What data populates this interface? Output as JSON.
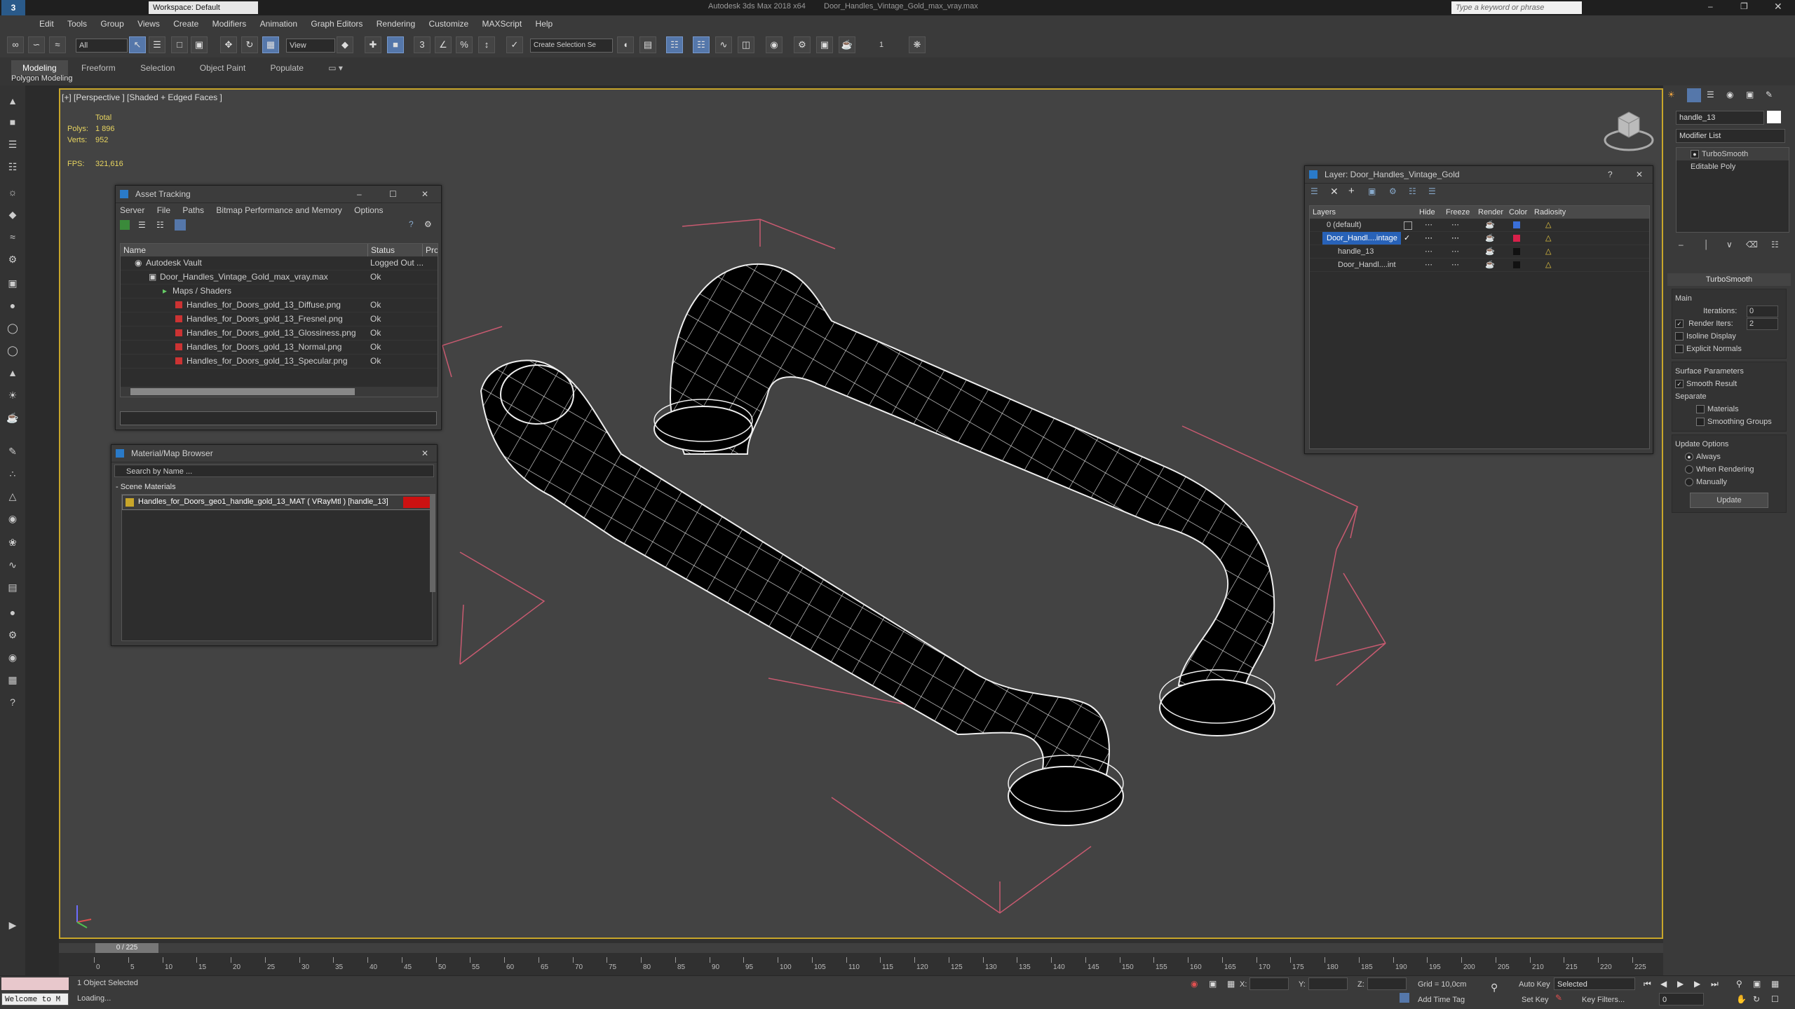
{
  "titlebar": {
    "workspace_label": "Workspace: Default",
    "app_title": "Autodesk 3ds Max  2018 x64",
    "file_title": "Door_Handles_Vintage_Gold_max_vray.max",
    "search_placeholder": "Type a keyword or phrase"
  },
  "menubar": {
    "items": [
      "Edit",
      "Tools",
      "Group",
      "Views",
      "Create",
      "Modifiers",
      "Animation",
      "Graph Editors",
      "Rendering",
      "Customize",
      "MAXScript",
      "Help"
    ]
  },
  "toolbar": {
    "filter_value": "All",
    "ref_coord_value": "View",
    "selection_set_placeholder": "Create Selection Se",
    "counter": "1"
  },
  "ribbon": {
    "tabs": [
      "Modeling",
      "Freeform",
      "Selection",
      "Object Paint",
      "Populate"
    ],
    "subtitle": "Polygon Modeling"
  },
  "viewport": {
    "label": "[+] [Perspective ] [Shaded + Edged Faces ]",
    "stats": {
      "total_label": "Total",
      "polys_label": "Polys:",
      "polys_value": "1 896",
      "verts_label": "Verts:",
      "verts_value": "952",
      "fps_label": "FPS:",
      "fps_value": "321,616"
    }
  },
  "asset_tracking": {
    "title": "Asset Tracking",
    "menu": [
      "Server",
      "File",
      "Paths",
      "Bitmap Performance and Memory",
      "Options"
    ],
    "columns": [
      "Name",
      "Status",
      "Pro"
    ],
    "rows": [
      {
        "name": "Autodesk Vault",
        "status": "Logged Out ..."
      },
      {
        "name": "Door_Handles_Vintage_Gold_max_vray.max",
        "status": "Ok"
      },
      {
        "name": "Maps / Shaders",
        "status": ""
      },
      {
        "name": "Handles_for_Doors_gold_13_Diffuse.png",
        "status": "Ok"
      },
      {
        "name": "Handles_for_Doors_gold_13_Fresnel.png",
        "status": "Ok"
      },
      {
        "name": "Handles_for_Doors_gold_13_Glossiness.png",
        "status": "Ok"
      },
      {
        "name": "Handles_for_Doors_gold_13_Normal.png",
        "status": "Ok"
      },
      {
        "name": "Handles_for_Doors_gold_13_Specular.png",
        "status": "Ok"
      }
    ]
  },
  "material_browser": {
    "title": "Material/Map Browser",
    "search_placeholder": "Search by Name ...",
    "group_label": "- Scene Materials",
    "material": "Handles_for_Doors_geo1_handle_gold_13_MAT ( VRayMtl ) [handle_13]",
    "accent_color": "#cc1111"
  },
  "layer_explorer": {
    "title": "Layer: Door_Handles_Vintage_Gold",
    "columns": [
      "Layers",
      "Hide",
      "Freeze",
      "Render",
      "Color",
      "Radiosity"
    ],
    "rows": [
      {
        "name": "0 (default)",
        "color": "#3a6fd8"
      },
      {
        "name": "Door_Handl....intage",
        "color": "#d8204a"
      },
      {
        "name": "handle_13",
        "color": "#111111"
      },
      {
        "name": "Door_Handl....int",
        "color": "#111111"
      }
    ]
  },
  "command_panel": {
    "object_name": "handle_13",
    "modifier_list_label": "Modifier List",
    "stack": [
      "TurboSmooth",
      "Editable Poly"
    ],
    "turbosmooth": {
      "header": "TurboSmooth",
      "main_label": "Main",
      "iterations_label": "Iterations:",
      "iterations_value": "0",
      "render_iters_label": "Render Iters:",
      "render_iters_value": "2",
      "isoline_label": "Isoline Display",
      "explicit_normals_label": "Explicit Normals",
      "surface_params_label": "Surface Parameters",
      "smooth_result_label": "Smooth Result",
      "separate_label": "Separate",
      "materials_label": "Materials",
      "smoothing_groups_label": "Smoothing Groups",
      "update_options_label": "Update Options",
      "always_label": "Always",
      "when_rendering_label": "When Rendering",
      "manually_label": "Manually",
      "update_button": "Update"
    }
  },
  "timeline": {
    "frame_counter": "0 / 225",
    "ticks": [
      "0",
      "5",
      "10",
      "15",
      "20",
      "25",
      "30",
      "35",
      "40",
      "45",
      "50",
      "55",
      "60",
      "65",
      "70",
      "75",
      "80",
      "85",
      "90",
      "95",
      "100",
      "105",
      "110",
      "115",
      "120",
      "125",
      "130",
      "135",
      "140",
      "145",
      "150",
      "155",
      "160",
      "165",
      "170",
      "175",
      "180",
      "185",
      "190",
      "195",
      "200",
      "205",
      "210",
      "215",
      "220",
      "225"
    ]
  },
  "statusbar": {
    "welcome": "Welcome to M",
    "selection_status": "1 Object Selected",
    "loading": "Loading...",
    "x_label": "X:",
    "y_label": "Y:",
    "z_label": "Z:",
    "grid": "Grid = 10,0cm",
    "add_time_tag": "Add Time Tag",
    "auto_key": "Auto Key",
    "selected_value": "Selected",
    "set_key": "Set Key",
    "key_filters": "Key Filters...",
    "current_frame": "0"
  },
  "colors": {
    "viewport_border": "#c8a62a",
    "selection_blue": "#2862b8",
    "bbox_pink": "#c85a70"
  }
}
